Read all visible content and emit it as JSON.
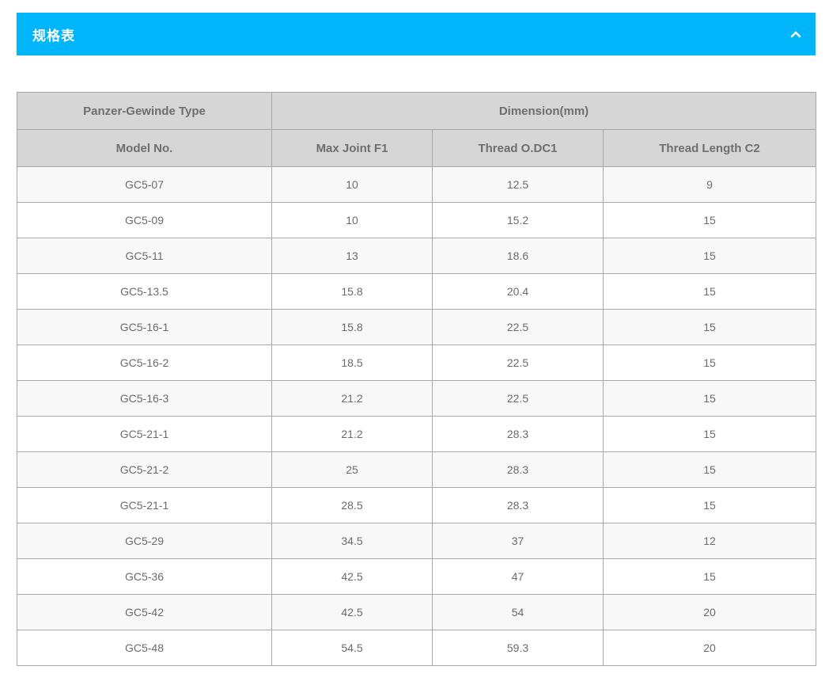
{
  "accordion": {
    "title": "规格表",
    "toggle_icon": "chevron-up-icon"
  },
  "table": {
    "group_headers": {
      "type": "Panzer-Gewinde Type",
      "dimension": "Dimension(mm)"
    },
    "columns": [
      "Model No.",
      "Max Joint F1",
      "Thread O.DC1",
      "Thread Length C2"
    ],
    "rows": [
      [
        "GC5-07",
        "10",
        "12.5",
        "9"
      ],
      [
        "GC5-09",
        "10",
        "15.2",
        "15"
      ],
      [
        "GC5-11",
        "13",
        "18.6",
        "15"
      ],
      [
        "GC5-13.5",
        "15.8",
        "20.4",
        "15"
      ],
      [
        "GC5-16-1",
        "15.8",
        "22.5",
        "15"
      ],
      [
        "GC5-16-2",
        "18.5",
        "22.5",
        "15"
      ],
      [
        "GC5-16-3",
        "21.2",
        "22.5",
        "15"
      ],
      [
        "GC5-21-1",
        "21.2",
        "28.3",
        "15"
      ],
      [
        "GC5-21-2",
        "25",
        "28.3",
        "15"
      ],
      [
        "GC5-21-1",
        "28.5",
        "28.3",
        "15"
      ],
      [
        "GC5-29",
        "34.5",
        "37",
        "12"
      ],
      [
        "GC5-36",
        "42.5",
        "47",
        "15"
      ],
      [
        "GC5-42",
        "42.5",
        "54",
        "20"
      ],
      [
        "GC5-48",
        "54.5",
        "59.3",
        "20"
      ]
    ]
  }
}
